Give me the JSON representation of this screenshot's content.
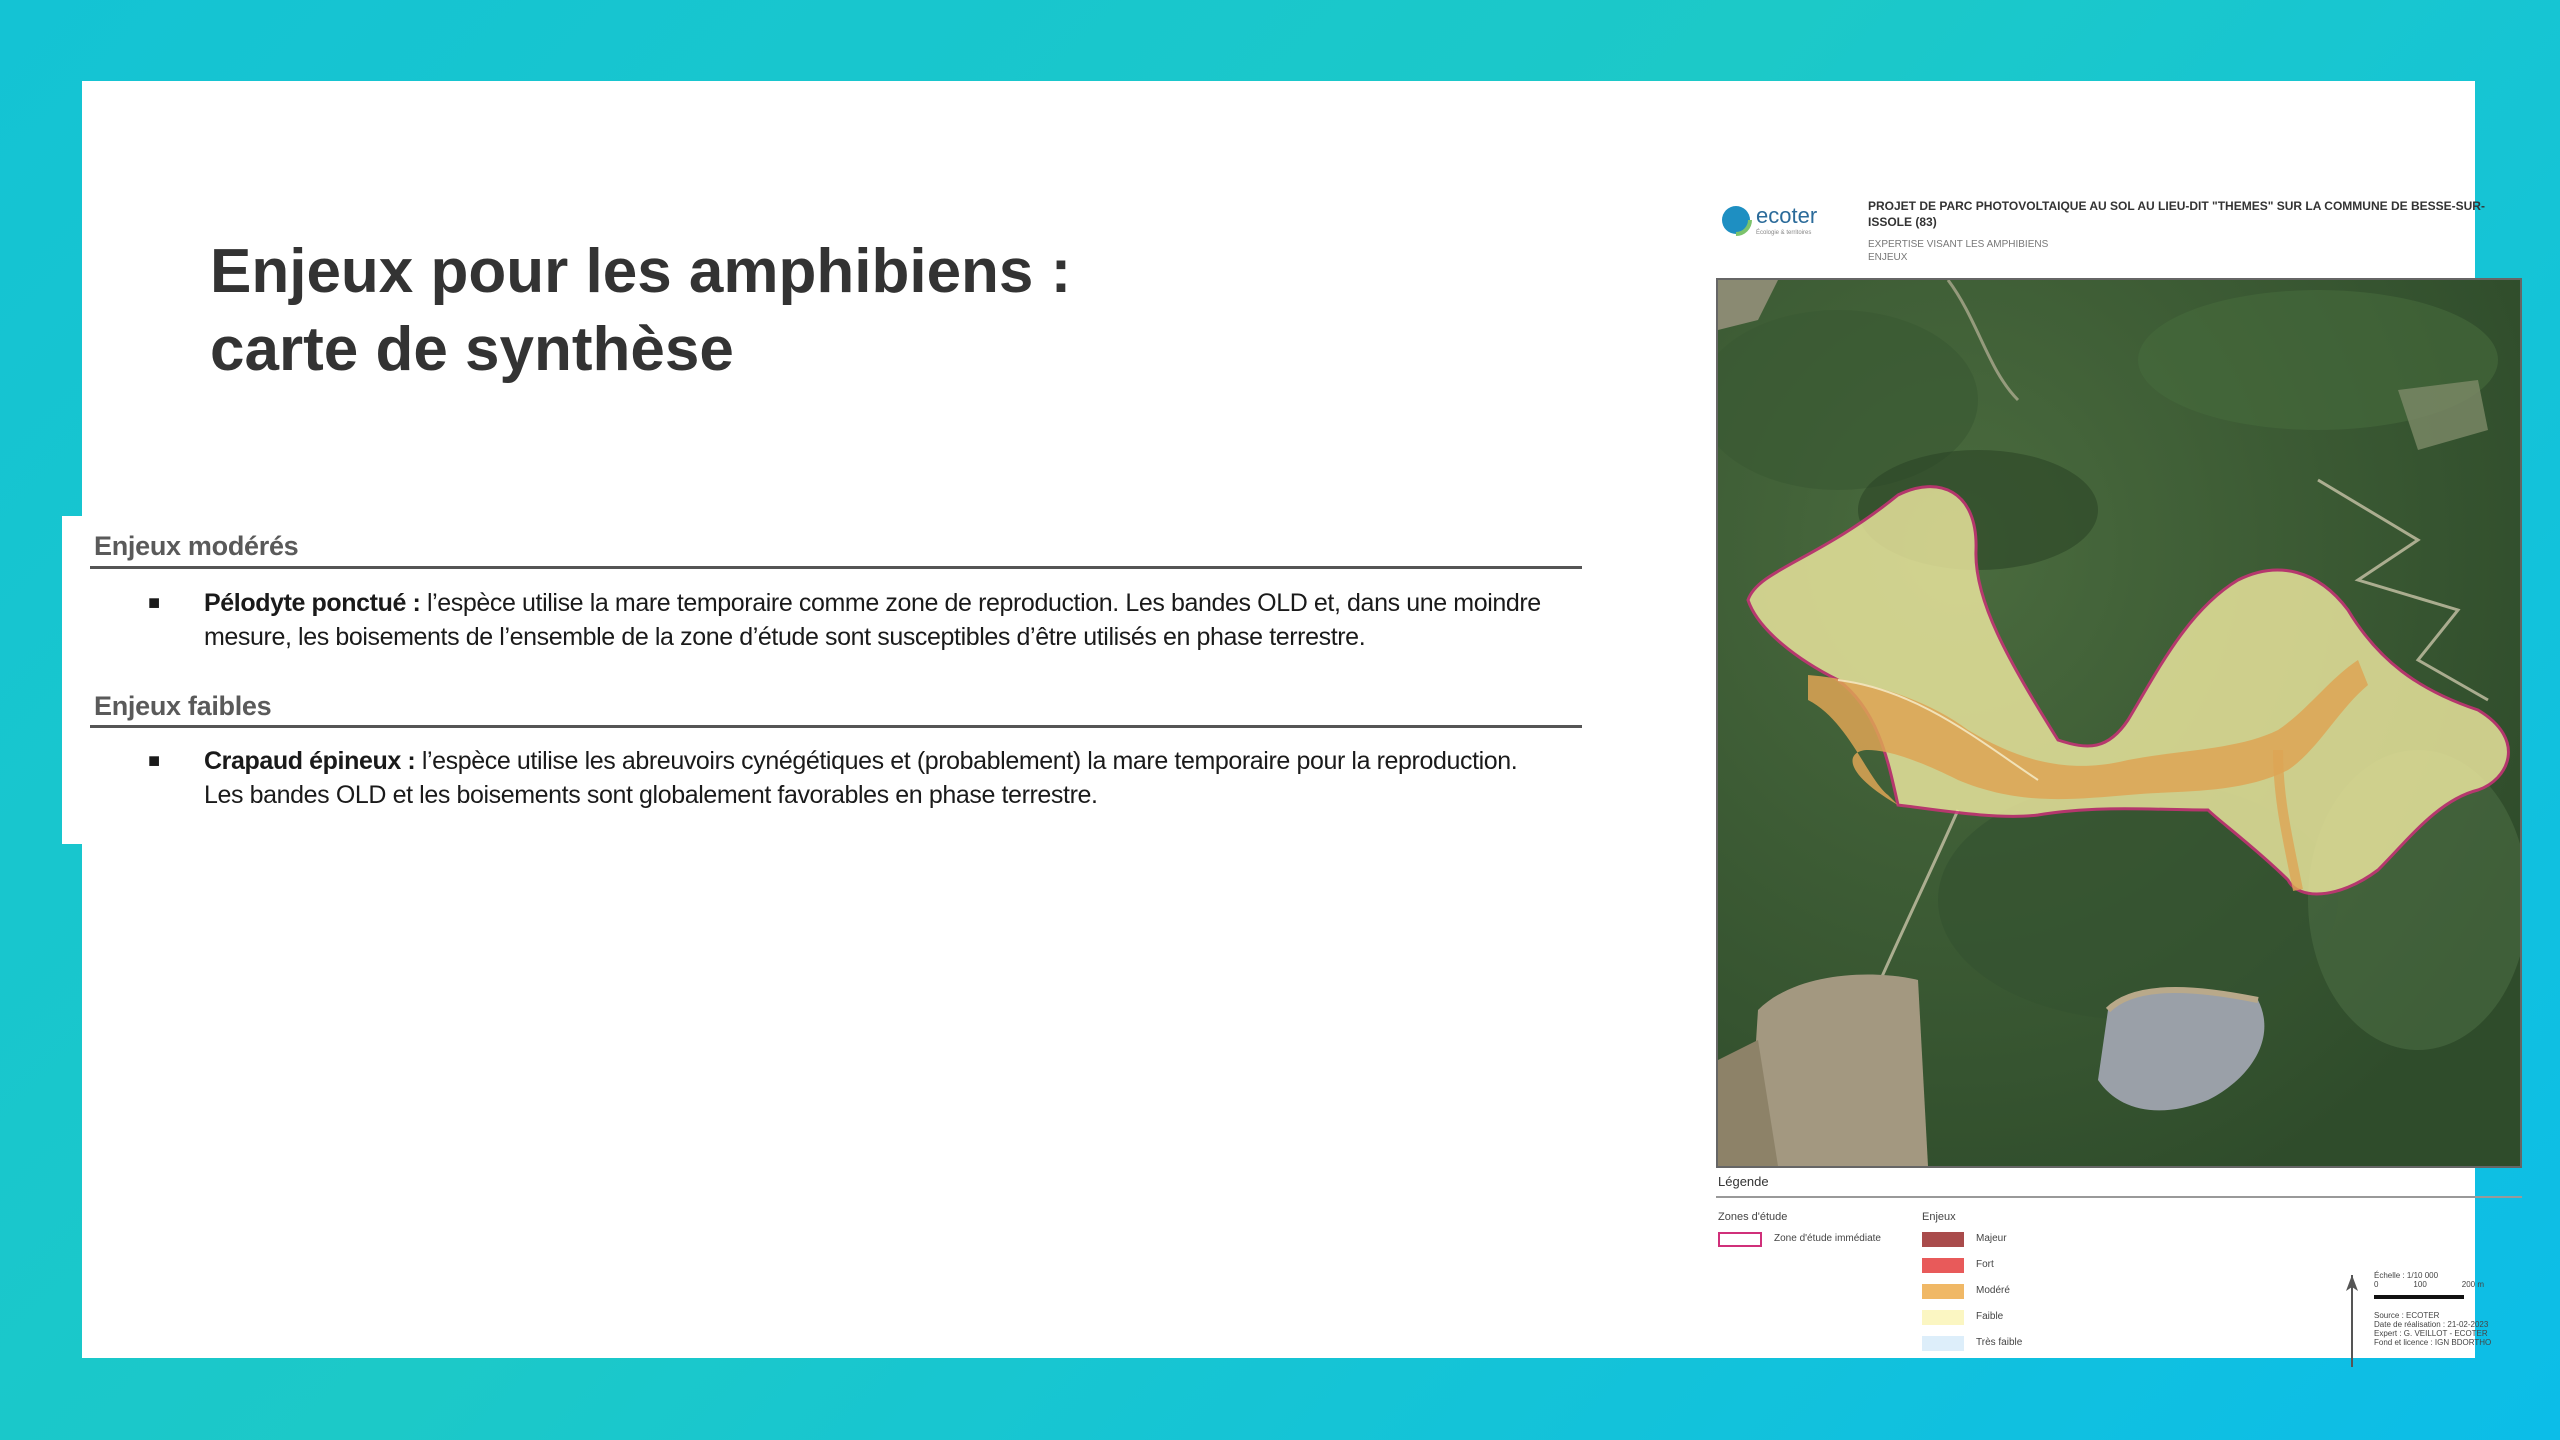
{
  "slide": {
    "title_line1": "Enjeux pour les amphibiens :",
    "title_line2": "carte de synthèse"
  },
  "sections": [
    {
      "heading": "Enjeux modérés",
      "bullet_bold": "Pélodyte ponctué :",
      "bullet_text_line1": " l’espèce utilise la mare temporaire comme zone de reproduction. Les bandes OLD et, dans une moindre",
      "bullet_text_line2": "mesure, les boisements de l’ensemble de la zone d’étude sont susceptibles d’être utilisés en phase terrestre."
    },
    {
      "heading": "Enjeux faibles",
      "bullet_bold": "Crapaud épineux :",
      "bullet_text_line1": " l’espèce utilise les abreuvoirs cynégétiques et (probablement)  la mare temporaire pour la reproduction.",
      "bullet_text_line2": "Les bandes OLD et les boisements sont globalement favorables en phase terrestre."
    }
  ],
  "map_sheet": {
    "logo_text": "ecoter",
    "logo_tagline": "Écologie & territoires",
    "project_title": "PROJET DE PARC PHOTOVOLTAIQUE AU SOL AU LIEU-DIT \"THEMES\" SUR LA COMMUNE DE BESSE-SUR-ISSOLE (83)",
    "subtitle_line1": "EXPERTISE VISANT LES AMPHIBIENS",
    "subtitle_line2": "ENJEUX",
    "legend_title": "Légende",
    "zones_heading": "Zones d'étude",
    "zones_item": "Zone d'étude immédiate",
    "enjeux_heading": "Enjeux",
    "enjeux_items": [
      {
        "label": "Majeur",
        "color": "#a94b4b"
      },
      {
        "label": "Fort",
        "color": "#e85a5a"
      },
      {
        "label": "Modéré",
        "color": "#f0b866"
      },
      {
        "label": "Faible",
        "color": "#fbf6c2"
      },
      {
        "label": "Très faible",
        "color": "#ddeefa"
      }
    ],
    "scale_label": "Échelle : 1/10 000",
    "scale_ticks": [
      "0",
      "100",
      "200 m"
    ],
    "source_line": "Source : ECOTER",
    "date_line": "Date de réalisation : 21-02-2023",
    "expert_line": "Expert : G. VEILLOT - ECOTER",
    "fond_line": "Fond et licence : IGN BDORTHO"
  },
  "colors": {
    "zone_outline": "#d0307a",
    "faible": "#eee9a0",
    "modere": "#dda555",
    "forest": "#3d5c35"
  }
}
